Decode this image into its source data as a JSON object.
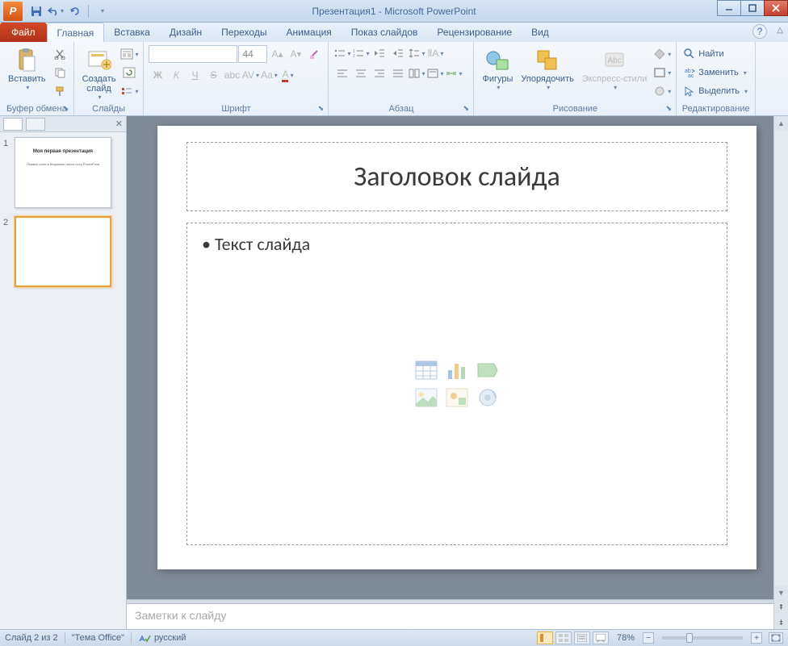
{
  "title": "Презентация1 - Microsoft PowerPoint",
  "file_tab": "Файл",
  "tabs": [
    "Главная",
    "Вставка",
    "Дизайн",
    "Переходы",
    "Анимация",
    "Показ слайдов",
    "Рецензирование",
    "Вид"
  ],
  "active_tab": 0,
  "ribbon": {
    "clipboard": {
      "label": "Буфер обмена",
      "paste": "Вставить"
    },
    "slides": {
      "label": "Слайды",
      "new": "Создать\nслайд"
    },
    "font": {
      "label": "Шрифт",
      "size": "44"
    },
    "paragraph": {
      "label": "Абзац"
    },
    "drawing": {
      "label": "Рисование",
      "shapes": "Фигуры",
      "arrange": "Упорядочить",
      "styles": "Экспресс-стили"
    },
    "editing": {
      "label": "Редактирование",
      "find": "Найти",
      "replace": "Заменить",
      "select": "Выделить"
    }
  },
  "thumbs": [
    {
      "num": "1",
      "title": "Моя первая презентация",
      "body": "Первые шаги в безумном тихом лесу PowerPoint"
    },
    {
      "num": "2",
      "title": "",
      "body": ""
    }
  ],
  "selected_thumb": 1,
  "slide": {
    "title_placeholder": "Заголовок слайда",
    "content_placeholder": "Текст слайда"
  },
  "notes_placeholder": "Заметки к слайду",
  "status": {
    "slide": "Слайд 2 из 2",
    "theme": "\"Тема Office\"",
    "lang": "русский",
    "zoom": "78%"
  }
}
